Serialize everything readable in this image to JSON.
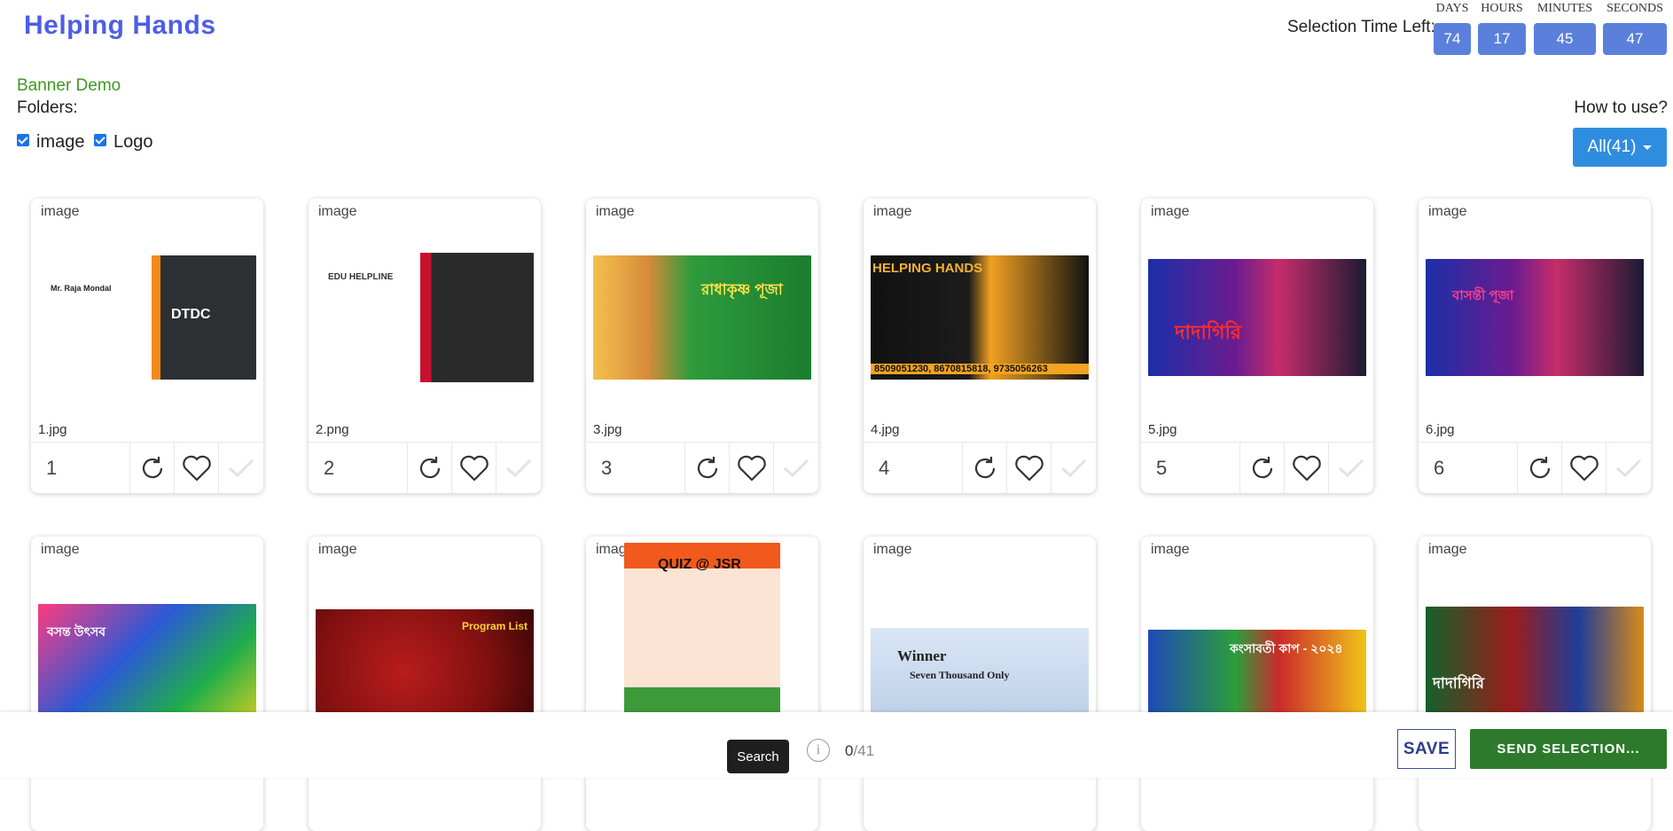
{
  "app": {
    "brand": "Helping Hands"
  },
  "timer": {
    "label": "Selection Time Left:",
    "units": [
      {
        "label": "DAYS",
        "value": "74"
      },
      {
        "label": "HOURS",
        "value": "17"
      },
      {
        "label": "MINUTES",
        "value": "45"
      },
      {
        "label": "SECONDS",
        "value": "47"
      }
    ]
  },
  "project": {
    "name": "Banner Demo",
    "folders_label": "Folders:"
  },
  "folders": [
    {
      "label": "image",
      "checked": true
    },
    {
      "label": "Logo",
      "checked": true
    }
  ],
  "help": {
    "how_to_use": "How to use?",
    "filter_label": "All(41)"
  },
  "gallery": {
    "cards": [
      {
        "folder": "image",
        "filename": "1.jpg",
        "number": "1",
        "thumb_text": "DTDC",
        "thumb_sub": "Mr. Raja Mondal"
      },
      {
        "folder": "image",
        "filename": "2.png",
        "number": "2",
        "thumb_text": "EDU HELPLINE",
        "thumb_sub": ""
      },
      {
        "folder": "image",
        "filename": "3.jpg",
        "number": "3",
        "thumb_text": "রাধাকৃষ্ণ পূজা",
        "thumb_sub": ""
      },
      {
        "folder": "image",
        "filename": "4.jpg",
        "number": "4",
        "thumb_text": "HELPING HANDS",
        "thumb_sub": "8509051230, 8670815818, 9735056263"
      },
      {
        "folder": "image",
        "filename": "5.jpg",
        "number": "5",
        "thumb_text": "দাদাগিরি",
        "thumb_sub": ""
      },
      {
        "folder": "image",
        "filename": "6.jpg",
        "number": "6",
        "thumb_text": "বাসন্তী পূজা",
        "thumb_sub": ""
      },
      {
        "folder": "image",
        "filename": "",
        "number": "",
        "thumb_text": "বসন্ত উৎসব",
        "thumb_sub": ""
      },
      {
        "folder": "image",
        "filename": "",
        "number": "",
        "thumb_text": "Program List",
        "thumb_sub": ""
      },
      {
        "folder": "image",
        "filename": "",
        "number": "",
        "thumb_text": "QUIZ @ JSR",
        "thumb_sub": ""
      },
      {
        "folder": "image",
        "filename": "",
        "number": "",
        "thumb_text": "Winner",
        "thumb_sub": "Seven Thousand Only"
      },
      {
        "folder": "image",
        "filename": "",
        "number": "",
        "thumb_text": "কংসাবতী কাপ - ২০২৪",
        "thumb_sub": ""
      },
      {
        "folder": "image",
        "filename": "",
        "number": "",
        "thumb_text": "দাদাগিরি",
        "thumb_sub": ""
      }
    ]
  },
  "footer": {
    "search_label": "Search",
    "selected_count": "0",
    "total_count": "/41",
    "save_label": "SAVE",
    "send_label": "SEND SELECTION..."
  },
  "colors": {
    "brand": "#4d5ee6",
    "timer_box": "#5b80dc",
    "filter_button": "#2f8de0",
    "send_button": "#2d7a2d",
    "project": "#3d9a1e"
  },
  "icons": {
    "refresh": "refresh-icon",
    "heart": "heart-icon",
    "check": "check-icon",
    "info": "info-icon",
    "caret": "caret-down-icon"
  }
}
